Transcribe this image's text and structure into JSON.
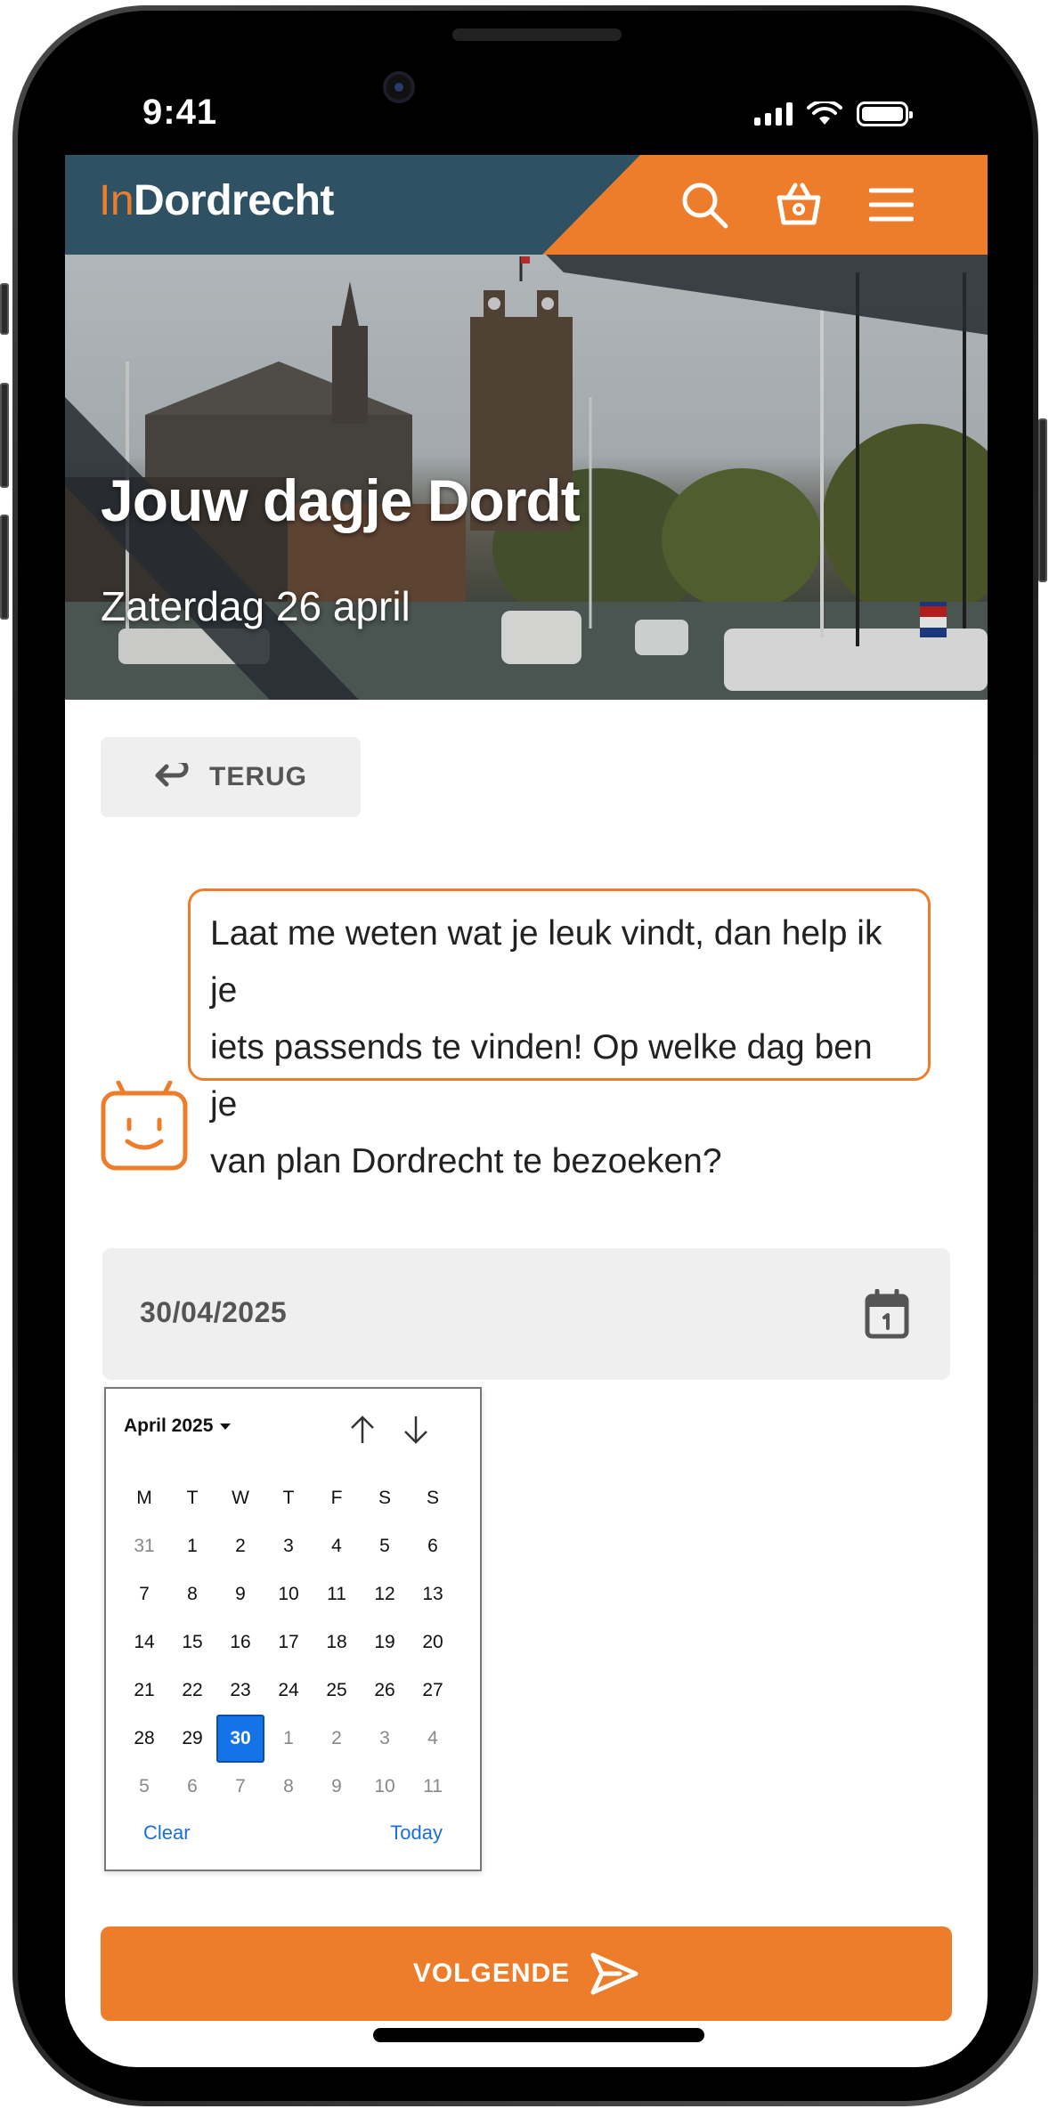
{
  "status_bar": {
    "time": "9:41"
  },
  "header": {
    "logo_prefix": "In",
    "logo_name": "Dordrecht",
    "icons": [
      "search-icon",
      "basket-icon",
      "menu-icon"
    ],
    "brand_color": "#2f5164",
    "accent_color": "#ed7d2a"
  },
  "hero": {
    "title": "Jouw dagje Dordt",
    "subtitle": "Zaterdag 26 april"
  },
  "back_button": {
    "label": "TERUG"
  },
  "chat": {
    "line1": "Laat me weten wat je leuk vindt, dan help ik je",
    "line2": "iets passends te vinden! Op welke dag ben je",
    "line3": "van plan Dordrecht te bezoeken?"
  },
  "date_field": {
    "value": "30/04/2025"
  },
  "datepicker": {
    "month_label": "April 2025",
    "weekdays": [
      "M",
      "T",
      "W",
      "T",
      "F",
      "S",
      "S"
    ],
    "weeks": [
      [
        {
          "d": "31",
          "m": true
        },
        {
          "d": "1"
        },
        {
          "d": "2"
        },
        {
          "d": "3"
        },
        {
          "d": "4"
        },
        {
          "d": "5"
        },
        {
          "d": "6"
        }
      ],
      [
        {
          "d": "7"
        },
        {
          "d": "8"
        },
        {
          "d": "9"
        },
        {
          "d": "10"
        },
        {
          "d": "11"
        },
        {
          "d": "12"
        },
        {
          "d": "13"
        }
      ],
      [
        {
          "d": "14"
        },
        {
          "d": "15"
        },
        {
          "d": "16"
        },
        {
          "d": "17"
        },
        {
          "d": "18"
        },
        {
          "d": "19"
        },
        {
          "d": "20"
        }
      ],
      [
        {
          "d": "21"
        },
        {
          "d": "22"
        },
        {
          "d": "23"
        },
        {
          "d": "24"
        },
        {
          "d": "25"
        },
        {
          "d": "26"
        },
        {
          "d": "27"
        }
      ],
      [
        {
          "d": "28"
        },
        {
          "d": "29"
        },
        {
          "d": "30",
          "s": true
        },
        {
          "d": "1",
          "m": true
        },
        {
          "d": "2",
          "m": true
        },
        {
          "d": "3",
          "m": true
        },
        {
          "d": "4",
          "m": true
        }
      ],
      [
        {
          "d": "5",
          "m": true
        },
        {
          "d": "6",
          "m": true
        },
        {
          "d": "7",
          "m": true
        },
        {
          "d": "8",
          "m": true
        },
        {
          "d": "9",
          "m": true
        },
        {
          "d": "10",
          "m": true
        },
        {
          "d": "11",
          "m": true
        }
      ]
    ],
    "clear_label": "Clear",
    "today_label": "Today"
  },
  "next_button": {
    "label": "VOLGENDE"
  }
}
